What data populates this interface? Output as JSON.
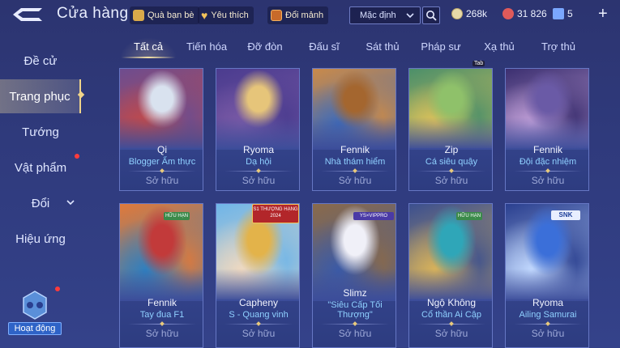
{
  "header": {
    "title": "Cửa hàng",
    "chips": [
      {
        "label": "Quà bạn bè",
        "icon": "gift-icon"
      },
      {
        "label": "Yêu thích",
        "icon": "heart-icon"
      },
      {
        "label": "Đổi mảnh",
        "icon": "shard-exchange-icon"
      }
    ],
    "sort_value": "Mặc định",
    "currencies": [
      {
        "value": "268k",
        "icon": "gold-coin-icon",
        "color": "#e7d9a8"
      },
      {
        "value": "31 826",
        "icon": "gem-icon",
        "color": "#e05a5a"
      },
      {
        "value": "5",
        "icon": "voucher-icon",
        "color": "#7aa7ff"
      }
    ],
    "plus_label": "+"
  },
  "sidebar": {
    "items": [
      {
        "label": "Đề cử"
      },
      {
        "label": "Trang phục",
        "active": true
      },
      {
        "label": "Tướng"
      },
      {
        "label": "Vật phẩm",
        "badge": true
      },
      {
        "label": "Đổi",
        "expandable": true
      },
      {
        "label": "Hiệu ứng"
      }
    ],
    "event_label": "Hoạt động"
  },
  "tabs": [
    {
      "label": "Tất cả",
      "active": true
    },
    {
      "label": "Tiến hóa"
    },
    {
      "label": "Đỡ đòn"
    },
    {
      "label": "Đấu sĩ"
    },
    {
      "label": "Sát thủ"
    },
    {
      "label": "Pháp sư"
    },
    {
      "label": "Xạ thủ"
    },
    {
      "label": "Trợ thủ"
    }
  ],
  "tab_hint": "Tab",
  "skins": [
    {
      "hero": "Qi",
      "skin": "Blogger Ẩm thực",
      "status": "Sở hữu",
      "art": [
        "#d9e2ef",
        "#c24a4a",
        "#6d4c8f"
      ]
    },
    {
      "hero": "Ryoma",
      "skin": "Dạ hội",
      "status": "Sở hữu",
      "art": [
        "#e6c57a",
        "#7a5aa6",
        "#4b3c8f"
      ]
    },
    {
      "hero": "Fennik",
      "skin": "Nhà thám hiểm",
      "status": "Sở hữu",
      "art": [
        "#a4662f",
        "#3f6bb8",
        "#c98a4a"
      ]
    },
    {
      "hero": "Zip",
      "skin": "Cá siêu quậy",
      "status": "Sở hữu",
      "art": [
        "#8fc16a",
        "#e0c35a",
        "#4b8f6a"
      ]
    },
    {
      "hero": "Fennik",
      "skin": "Đội đặc nhiệm",
      "status": "Sở hữu",
      "art": [
        "#6a5aa6",
        "#c2a0d9",
        "#3b2f70"
      ]
    },
    {
      "hero": "Fennik",
      "skin": "Tay đua F1",
      "status": "Sở hữu",
      "art": [
        "#c23a3a",
        "#2f7fbf",
        "#e07a3a"
      ],
      "badge": "HỮU HẠN"
    },
    {
      "hero": "Capheny",
      "skin": "S - Quang vinh",
      "status": "Sở hữu",
      "art": [
        "#e3b34a",
        "#f0d9c0",
        "#6fb5e8"
      ],
      "badge": "S1 THƯỢNG HẠNG 2024"
    },
    {
      "hero": "Slimz",
      "skin": "\"Siêu Cấp Tối Thượng\"",
      "status": "Sở hữu",
      "art": [
        "#f0f0f8",
        "#3b5aa6",
        "#8a6a4a"
      ],
      "badge": "YS×VIPPRO"
    },
    {
      "hero": "Ngộ Không",
      "skin": "Cổ thần Ai Cập",
      "status": "Sở hữu",
      "art": [
        "#2fa6b8",
        "#d9b35a",
        "#3b4f8f"
      ],
      "badge": "HỮU HẠN"
    },
    {
      "hero": "Ryoma",
      "skin": "Ailing Samurai",
      "status": "Sở hữu",
      "art": [
        "#3b6fd9",
        "#c2d9ff",
        "#2a3f8f"
      ],
      "badge": "SNK"
    }
  ]
}
